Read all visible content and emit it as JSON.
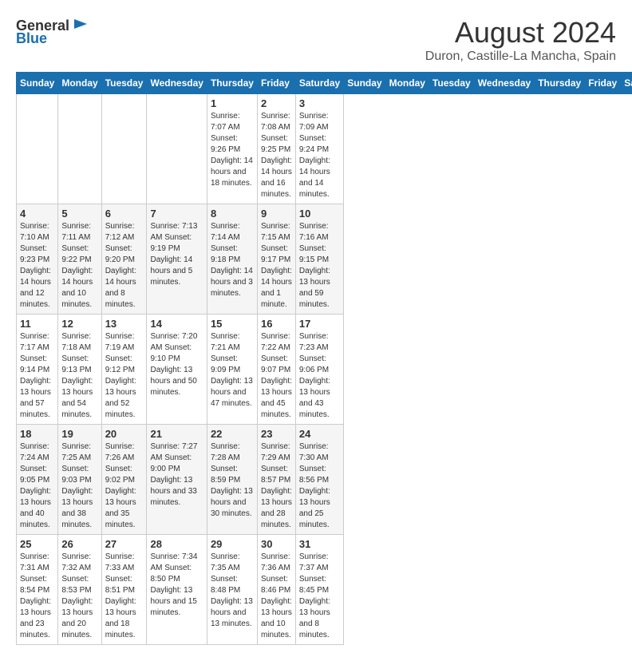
{
  "header": {
    "logo_general": "General",
    "logo_blue": "Blue",
    "month_year": "August 2024",
    "location": "Duron, Castille-La Mancha, Spain"
  },
  "calendar": {
    "days_of_week": [
      "Sunday",
      "Monday",
      "Tuesday",
      "Wednesday",
      "Thursday",
      "Friday",
      "Saturday"
    ],
    "weeks": [
      [
        {
          "day": "",
          "info": ""
        },
        {
          "day": "",
          "info": ""
        },
        {
          "day": "",
          "info": ""
        },
        {
          "day": "",
          "info": ""
        },
        {
          "day": "1",
          "info": "Sunrise: 7:07 AM\nSunset: 9:26 PM\nDaylight: 14 hours\nand 18 minutes."
        },
        {
          "day": "2",
          "info": "Sunrise: 7:08 AM\nSunset: 9:25 PM\nDaylight: 14 hours\nand 16 minutes."
        },
        {
          "day": "3",
          "info": "Sunrise: 7:09 AM\nSunset: 9:24 PM\nDaylight: 14 hours\nand 14 minutes."
        }
      ],
      [
        {
          "day": "4",
          "info": "Sunrise: 7:10 AM\nSunset: 9:23 PM\nDaylight: 14 hours\nand 12 minutes."
        },
        {
          "day": "5",
          "info": "Sunrise: 7:11 AM\nSunset: 9:22 PM\nDaylight: 14 hours\nand 10 minutes."
        },
        {
          "day": "6",
          "info": "Sunrise: 7:12 AM\nSunset: 9:20 PM\nDaylight: 14 hours\nand 8 minutes."
        },
        {
          "day": "7",
          "info": "Sunrise: 7:13 AM\nSunset: 9:19 PM\nDaylight: 14 hours\nand 5 minutes."
        },
        {
          "day": "8",
          "info": "Sunrise: 7:14 AM\nSunset: 9:18 PM\nDaylight: 14 hours\nand 3 minutes."
        },
        {
          "day": "9",
          "info": "Sunrise: 7:15 AM\nSunset: 9:17 PM\nDaylight: 14 hours\nand 1 minute."
        },
        {
          "day": "10",
          "info": "Sunrise: 7:16 AM\nSunset: 9:15 PM\nDaylight: 13 hours\nand 59 minutes."
        }
      ],
      [
        {
          "day": "11",
          "info": "Sunrise: 7:17 AM\nSunset: 9:14 PM\nDaylight: 13 hours\nand 57 minutes."
        },
        {
          "day": "12",
          "info": "Sunrise: 7:18 AM\nSunset: 9:13 PM\nDaylight: 13 hours\nand 54 minutes."
        },
        {
          "day": "13",
          "info": "Sunrise: 7:19 AM\nSunset: 9:12 PM\nDaylight: 13 hours\nand 52 minutes."
        },
        {
          "day": "14",
          "info": "Sunrise: 7:20 AM\nSunset: 9:10 PM\nDaylight: 13 hours\nand 50 minutes."
        },
        {
          "day": "15",
          "info": "Sunrise: 7:21 AM\nSunset: 9:09 PM\nDaylight: 13 hours\nand 47 minutes."
        },
        {
          "day": "16",
          "info": "Sunrise: 7:22 AM\nSunset: 9:07 PM\nDaylight: 13 hours\nand 45 minutes."
        },
        {
          "day": "17",
          "info": "Sunrise: 7:23 AM\nSunset: 9:06 PM\nDaylight: 13 hours\nand 43 minutes."
        }
      ],
      [
        {
          "day": "18",
          "info": "Sunrise: 7:24 AM\nSunset: 9:05 PM\nDaylight: 13 hours\nand 40 minutes."
        },
        {
          "day": "19",
          "info": "Sunrise: 7:25 AM\nSunset: 9:03 PM\nDaylight: 13 hours\nand 38 minutes."
        },
        {
          "day": "20",
          "info": "Sunrise: 7:26 AM\nSunset: 9:02 PM\nDaylight: 13 hours\nand 35 minutes."
        },
        {
          "day": "21",
          "info": "Sunrise: 7:27 AM\nSunset: 9:00 PM\nDaylight: 13 hours\nand 33 minutes."
        },
        {
          "day": "22",
          "info": "Sunrise: 7:28 AM\nSunset: 8:59 PM\nDaylight: 13 hours\nand 30 minutes."
        },
        {
          "day": "23",
          "info": "Sunrise: 7:29 AM\nSunset: 8:57 PM\nDaylight: 13 hours\nand 28 minutes."
        },
        {
          "day": "24",
          "info": "Sunrise: 7:30 AM\nSunset: 8:56 PM\nDaylight: 13 hours\nand 25 minutes."
        }
      ],
      [
        {
          "day": "25",
          "info": "Sunrise: 7:31 AM\nSunset: 8:54 PM\nDaylight: 13 hours\nand 23 minutes."
        },
        {
          "day": "26",
          "info": "Sunrise: 7:32 AM\nSunset: 8:53 PM\nDaylight: 13 hours\nand 20 minutes."
        },
        {
          "day": "27",
          "info": "Sunrise: 7:33 AM\nSunset: 8:51 PM\nDaylight: 13 hours\nand 18 minutes."
        },
        {
          "day": "28",
          "info": "Sunrise: 7:34 AM\nSunset: 8:50 PM\nDaylight: 13 hours\nand 15 minutes."
        },
        {
          "day": "29",
          "info": "Sunrise: 7:35 AM\nSunset: 8:48 PM\nDaylight: 13 hours\nand 13 minutes."
        },
        {
          "day": "30",
          "info": "Sunrise: 7:36 AM\nSunset: 8:46 PM\nDaylight: 13 hours\nand 10 minutes."
        },
        {
          "day": "31",
          "info": "Sunrise: 7:37 AM\nSunset: 8:45 PM\nDaylight: 13 hours\nand 8 minutes."
        }
      ]
    ]
  }
}
